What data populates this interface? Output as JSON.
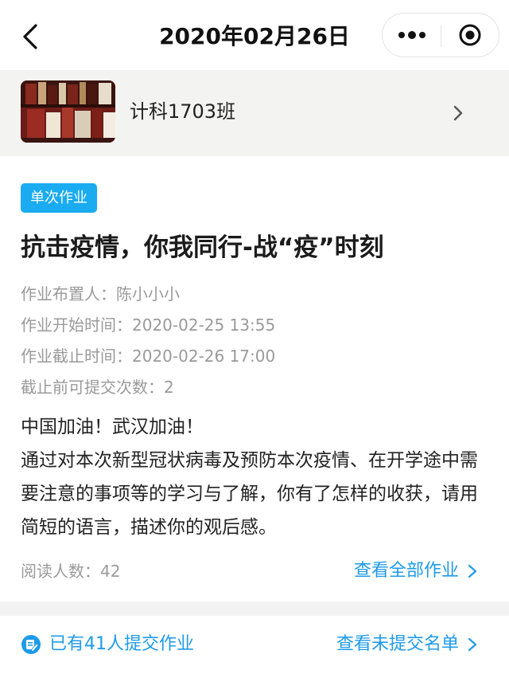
{
  "nav": {
    "title": "2020年02月26日"
  },
  "class_banner": {
    "name": "计科1703班"
  },
  "assignment": {
    "tag": "单次作业",
    "title": "抗击疫情，你我同行-战“疫”时刻",
    "publisher": "作业布置人：陈小小小",
    "start_time": "作业开始时间：2020-02-25 13:55",
    "end_time": "作业截止时间：2020-02-26 17:00",
    "submit_limit": "截止前可提交次数：2",
    "description_line1": "中国加油！武汉加油！",
    "description_line2": "通过对本次新型冠状病毒及预防本次疫情、在开学途中需要注意的事项等的学习与了解，你有了怎样的收获，请用简短的语言，描述你的观后感。",
    "read_count": "阅读人数：42",
    "view_all_label": "查看全部作业"
  },
  "footer": {
    "submitted_text": "已有41人提交作业",
    "view_unsubmitted_label": "查看未提交名单"
  },
  "colors": {
    "accent": "#1e9be8",
    "tag_bg": "#1aabf0",
    "banner_bg": "#f3f3f1"
  }
}
